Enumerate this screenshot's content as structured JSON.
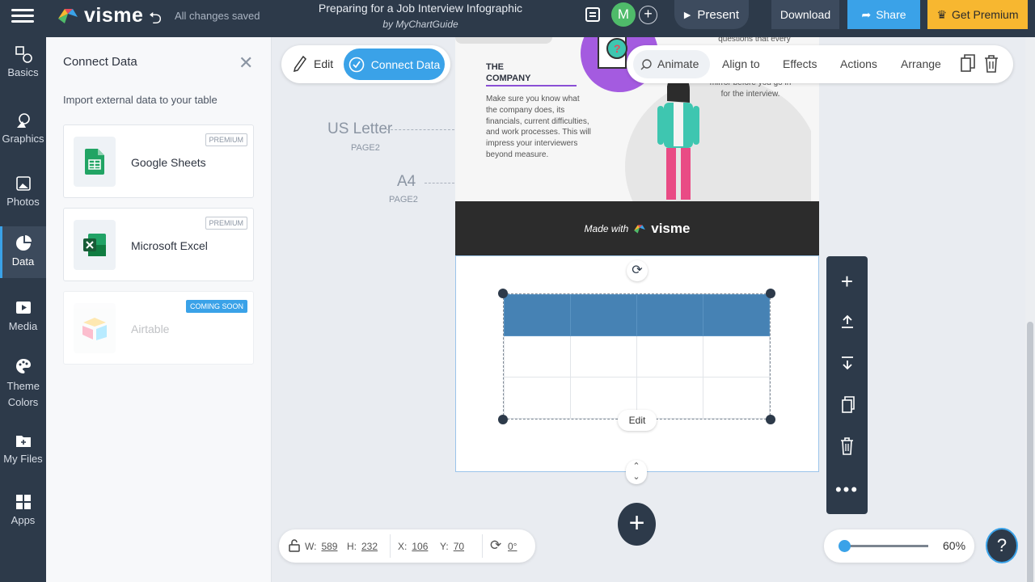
{
  "topbar": {
    "logo_text": "visme",
    "saved_status": "All changes saved",
    "doc_title": "Preparing for a Job Interview Infographic",
    "doc_subtitle": "by MyChartGuide",
    "avatar_initial": "M",
    "present_label": "Present",
    "download_label": "Download",
    "share_label": "Share",
    "premium_label": "Get Premium"
  },
  "rail": {
    "items": [
      {
        "label": "Basics"
      },
      {
        "label": "Graphics"
      },
      {
        "label": "Photos"
      },
      {
        "label": "Data"
      },
      {
        "label": "Media"
      },
      {
        "label": "Theme Colors"
      },
      {
        "label": "My Files"
      },
      {
        "label": "Apps"
      }
    ]
  },
  "panel": {
    "title": "Connect Data",
    "description": "Import external data to your table",
    "sources": [
      {
        "name": "Google Sheets",
        "badge": "PREMIUM"
      },
      {
        "name": "Microsoft Excel",
        "badge": "PREMIUM"
      },
      {
        "name": "Airtable",
        "badge": "COMING SOON"
      }
    ]
  },
  "mode": {
    "edit_label": "Edit",
    "connect_label": "Connect Data"
  },
  "tools": {
    "animate": "Animate",
    "align": "Align to",
    "effects": "Effects",
    "actions": "Actions",
    "arrange": "Arrange"
  },
  "canvas": {
    "us_letter": "US Letter",
    "us_letter_page": "PAGE2",
    "a4": "A4",
    "a4_page": "PAGE2",
    "company_title_1": "THE",
    "company_title_2": "COMPANY",
    "company_text": "Make sure you know what the company does, its financials, current difficulties, and work processes. This will impress your interviewers beyond measure.",
    "questions_text": "questions that every",
    "mirror_text": "mirror before you go in for the interview.",
    "made_with": "Made with",
    "made_with_brand": "visme",
    "edit_chip": "Edit"
  },
  "dimensions": {
    "w_label": "W:",
    "w": "589",
    "h_label": "H:",
    "h": "232",
    "x_label": "X:",
    "x": "106",
    "y_label": "Y:",
    "y": "70",
    "rotation": "0°"
  },
  "zoom": {
    "value": "60%"
  },
  "help": {
    "label": "?"
  },
  "colors": {
    "accent": "#3aa2e8",
    "dark": "#2d3a4a",
    "premium": "#f7b730",
    "table_header": "#4682b4"
  }
}
